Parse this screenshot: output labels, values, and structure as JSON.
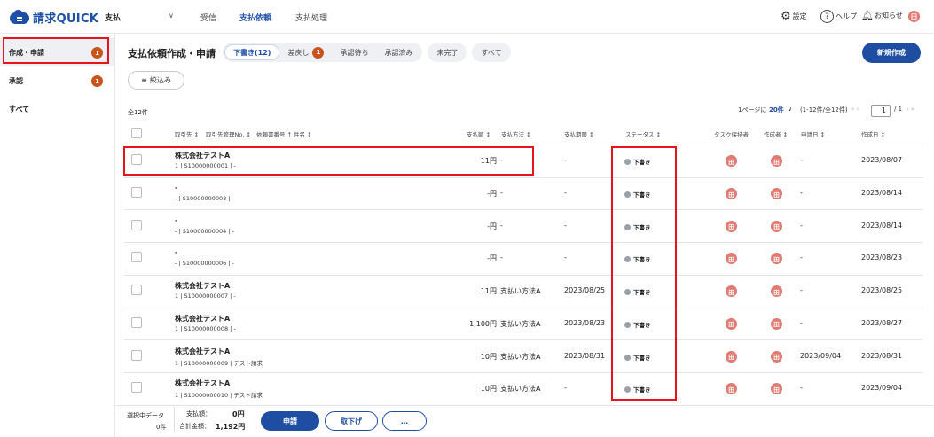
{
  "brand": {
    "name": "請求QUICK",
    "service": "支払"
  },
  "nav": [
    {
      "label": "受信"
    },
    {
      "label": "支払依頼"
    },
    {
      "label": "支払処理"
    }
  ],
  "header_right": {
    "settings": "設定",
    "help": "ヘルプ",
    "notice": "お知らせ",
    "avatar": "田"
  },
  "sidebar": [
    {
      "label": "作成・申請",
      "badge": "1"
    },
    {
      "label": "承認",
      "badge": "1"
    },
    {
      "label": "すべて"
    }
  ],
  "page": {
    "title": "支払依頼作成・申請",
    "new_button": "新規作成",
    "filter": "絞込み",
    "total": "全12件"
  },
  "tabs": [
    {
      "label": "下書き(12)"
    },
    {
      "label": "差戻し",
      "badge": "1"
    },
    {
      "label": "承認待ち"
    },
    {
      "label": "承認済み"
    },
    {
      "label": "未完了"
    },
    {
      "label": "すべて"
    }
  ],
  "pagination": {
    "per_page_label": "1ページに",
    "per_page": "20件",
    "range": "(1-12件/全12件)",
    "prev": "«  ‹",
    "page": "1",
    "of": "/ 1",
    "next": "›  »"
  },
  "columns": {
    "payee": "取引先 ↕",
    "mgmt": "取引先管理No. ↕",
    "docno": "依頼書番号 ↑",
    "subject": "件名 ↕",
    "amount": "支払額 ↕",
    "method": "支払方法 ↕",
    "due": "支払期限 ↕",
    "status": "ステータス ↕",
    "keeper": "タスク保持者",
    "creator": "作成者 ↕",
    "applied": "申請日 ↕",
    "created": "作成日 ↕"
  },
  "rows": [
    {
      "company": "株式会社テストA",
      "no": "1",
      "doc": "S10000000001",
      "subject": "-",
      "amount": "11円",
      "method": "-",
      "due": "-",
      "status": "下書き",
      "applied": "-",
      "created": "2023/08/07"
    },
    {
      "company": "-",
      "no": "-",
      "doc": "S10000000003",
      "subject": "-",
      "amount": "-円",
      "method": "-",
      "due": "-",
      "status": "下書き",
      "applied": "-",
      "created": "2023/08/14"
    },
    {
      "company": "-",
      "no": "-",
      "doc": "S10000000004",
      "subject": "-",
      "amount": "-円",
      "method": "-",
      "due": "-",
      "status": "下書き",
      "applied": "-",
      "created": "2023/08/14"
    },
    {
      "company": "-",
      "no": "-",
      "doc": "S10000000006",
      "subject": "-",
      "amount": "-円",
      "method": "-",
      "due": "-",
      "status": "下書き",
      "applied": "-",
      "created": "2023/08/23"
    },
    {
      "company": "株式会社テストA",
      "no": "1",
      "doc": "S10000000007",
      "subject": "-",
      "amount": "11円",
      "method": "支払い方法A",
      "due": "2023/08/25",
      "status": "下書き",
      "applied": "-",
      "created": "2023/08/25"
    },
    {
      "company": "株式会社テストA",
      "no": "1",
      "doc": "S10000000008",
      "subject": "-",
      "amount": "1,100円",
      "method": "支払い方法A",
      "due": "2023/08/23",
      "status": "下書き",
      "applied": "-",
      "created": "2023/08/27"
    },
    {
      "company": "株式会社テストA",
      "no": "1",
      "doc": "S10000000009",
      "subject": "テスト請求",
      "amount": "10円",
      "method": "支払い方法A",
      "due": "2023/08/31",
      "status": "下書き",
      "applied": "2023/09/04",
      "created": "2023/08/31"
    },
    {
      "company": "株式会社テストA",
      "no": "1",
      "doc": "S10000000010",
      "subject": "テスト請求",
      "amount": "10円",
      "method": "支払い方法A",
      "due": "-",
      "status": "下書き",
      "applied": "-",
      "created": "2023/09/04"
    }
  ],
  "row_avatar": "田",
  "footer": {
    "selected": "選択中データ",
    "selected_count": "0件",
    "pay_label": "支払額：",
    "pay_value": "0円",
    "sum_label": "合計金額：",
    "sum_value": "1,192円",
    "apply": "申請",
    "withdraw": "取下げ",
    "more": "…"
  }
}
